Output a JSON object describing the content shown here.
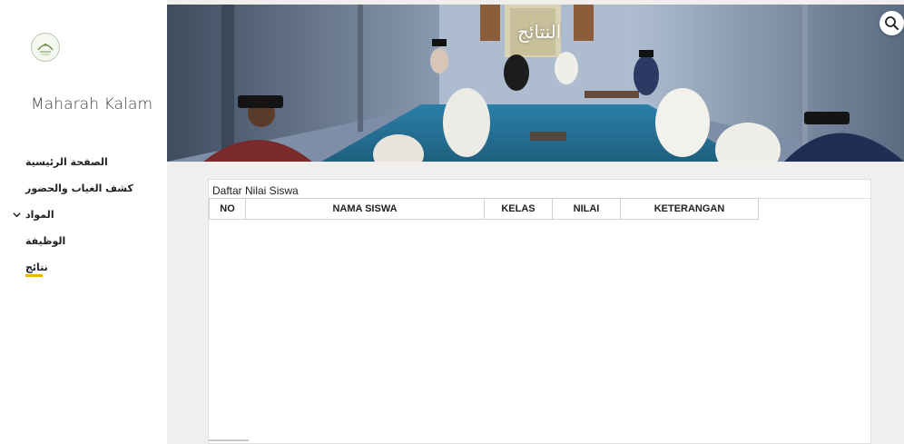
{
  "site": {
    "logo_text": "منابر",
    "title": "Maharah Kalam"
  },
  "nav": {
    "items": [
      {
        "label": "الصفحة الرئيسية"
      },
      {
        "label": "كشف الغياب والحضور"
      },
      {
        "label": "المواد",
        "expandable": true
      },
      {
        "label": "الوظيفة"
      },
      {
        "label": "نتائج",
        "active": true
      }
    ]
  },
  "hero": {
    "title": "النتائج"
  },
  "sheet": {
    "caption": "Daftar Nilai Siswa",
    "columns": [
      "NO",
      "NAMA SISWA",
      "KELAS",
      "NILAI",
      "KETERANGAN"
    ],
    "rows": []
  },
  "icons": {
    "search": "search-icon",
    "info": "info-icon",
    "chevron": "chevron-down-icon"
  },
  "colors": {
    "accent": "#f4b400",
    "background": "#f1efed"
  }
}
